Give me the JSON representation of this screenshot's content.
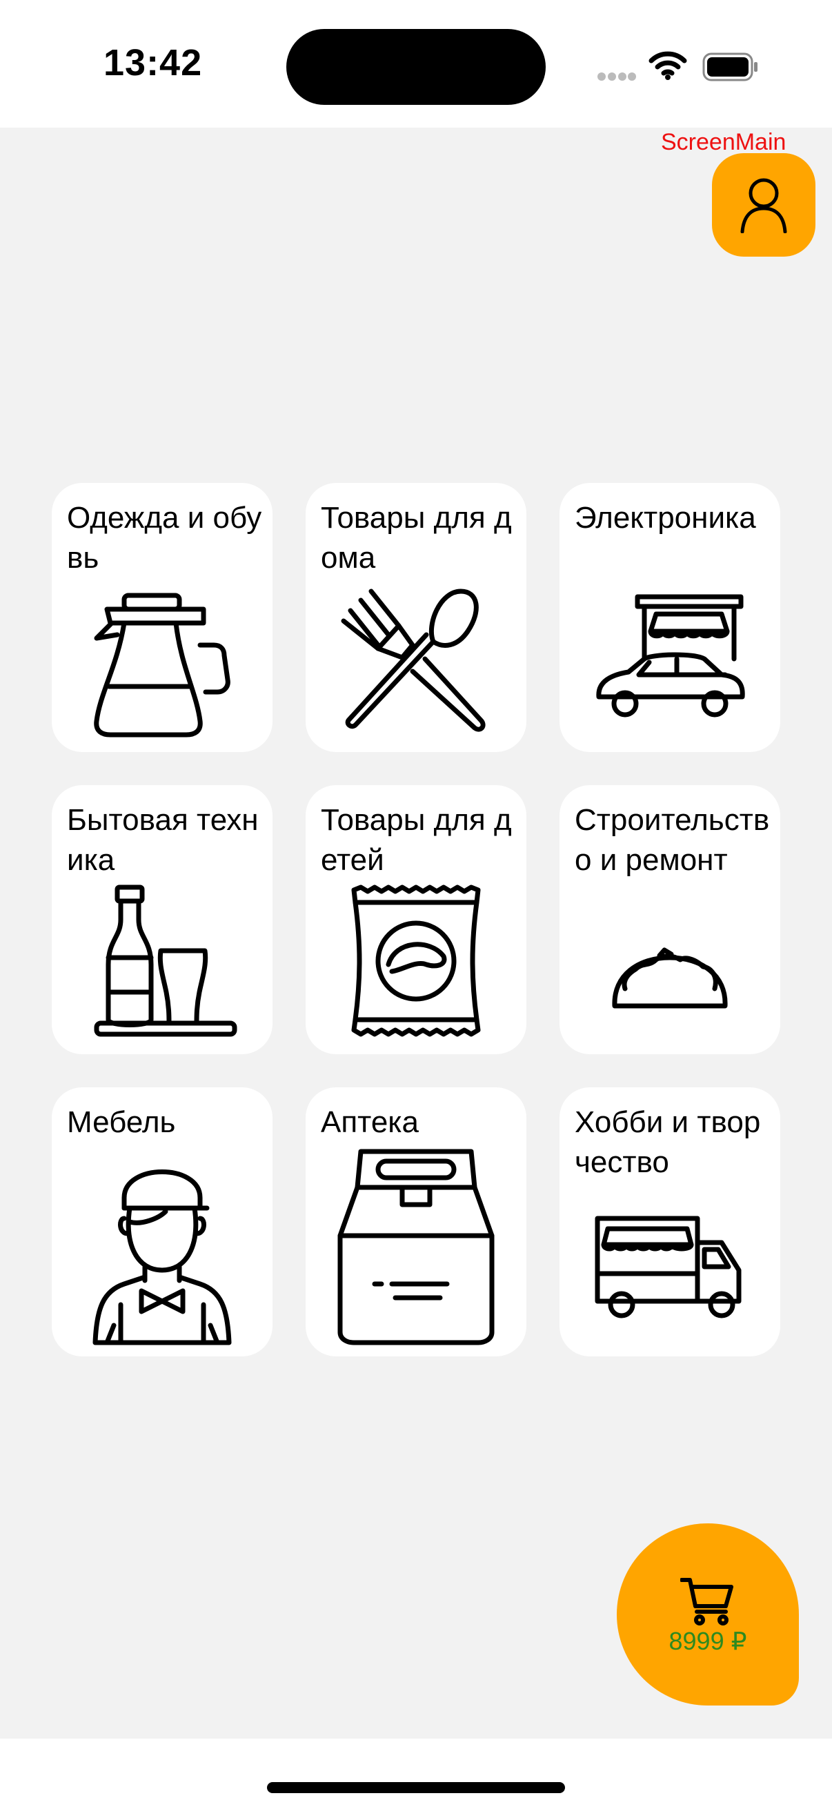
{
  "status_bar": {
    "time": "13:42"
  },
  "screen_label": "ScreenMain",
  "profile_button": {
    "icon": "person-icon"
  },
  "categories": [
    {
      "title": "Одежда и обувь",
      "icon": "coffee-pot-icon"
    },
    {
      "title": "Товары для дома",
      "icon": "fork-spoon-icon"
    },
    {
      "title": "Электроника",
      "icon": "car-shop-icon"
    },
    {
      "title": "Бытовая техника",
      "icon": "bottle-glass-icon"
    },
    {
      "title": "Товары для детей",
      "icon": "chips-bag-icon"
    },
    {
      "title": "Строительство и ремонт",
      "icon": "taco-icon"
    },
    {
      "title": "Мебель",
      "icon": "waiter-icon"
    },
    {
      "title": "Аптека",
      "icon": "paper-bag-icon"
    },
    {
      "title": "Хобби и творчество",
      "icon": "food-truck-icon"
    }
  ],
  "cart": {
    "icon": "cart-icon",
    "total": "8999 ₽"
  },
  "colors": {
    "accent": "#ffa500",
    "background": "#f2f2f2",
    "card": "#ffffff",
    "label_red": "#ee1111",
    "price_green": "#2d8a1f"
  }
}
